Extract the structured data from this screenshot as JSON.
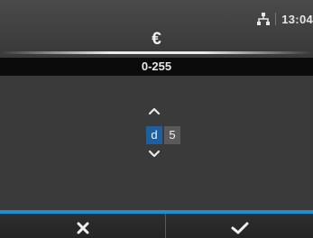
{
  "status_bar": {
    "time": "13:04",
    "network_icon": "network-icon"
  },
  "title": "€",
  "range": "0-255",
  "stepper": {
    "selected_digit": "d",
    "value_digit": "5",
    "up_icon": "chevron-up-icon",
    "down_icon": "chevron-down-icon"
  },
  "footer": {
    "cancel_icon": "close-icon",
    "confirm_icon": "check-icon",
    "accent_color": "#1b8fd0"
  }
}
